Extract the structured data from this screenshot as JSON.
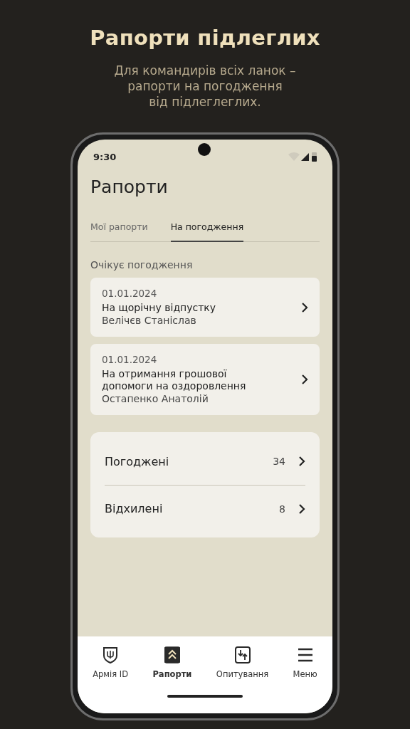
{
  "promo": {
    "title": "Рапорти підлеглих",
    "subtitle_lines": [
      "Для командирів всіх ланок –",
      "рапорти на погодження",
      "від підлеглеглих."
    ]
  },
  "status_bar": {
    "time": "9:30"
  },
  "screen": {
    "title": "Рапорти"
  },
  "tabs": [
    {
      "label": "Мої рапорти",
      "selected": false
    },
    {
      "label": "На погодження",
      "selected": true
    }
  ],
  "section_label": "Очікує погодження",
  "requests": [
    {
      "date": "01.01.2024",
      "title_lines": [
        "На щорічну відпустку"
      ],
      "author": "Велічєв Станіслав"
    },
    {
      "date": "01.01.2024",
      "title_lines": [
        "На отримання грошової",
        "допомоги на оздоровлення"
      ],
      "author": "Остапенко Анатолій"
    }
  ],
  "summary": [
    {
      "label": "Погоджені",
      "count": "34"
    },
    {
      "label": "Відхилені",
      "count": "8"
    }
  ],
  "bottom_nav": [
    {
      "kind": "shield",
      "label": "Армія ID",
      "selected": false
    },
    {
      "kind": "reports",
      "label": "Рапорти",
      "selected": true
    },
    {
      "kind": "poll",
      "label": "Опитування",
      "selected": false
    },
    {
      "kind": "menu",
      "label": "Меню",
      "selected": false
    }
  ]
}
